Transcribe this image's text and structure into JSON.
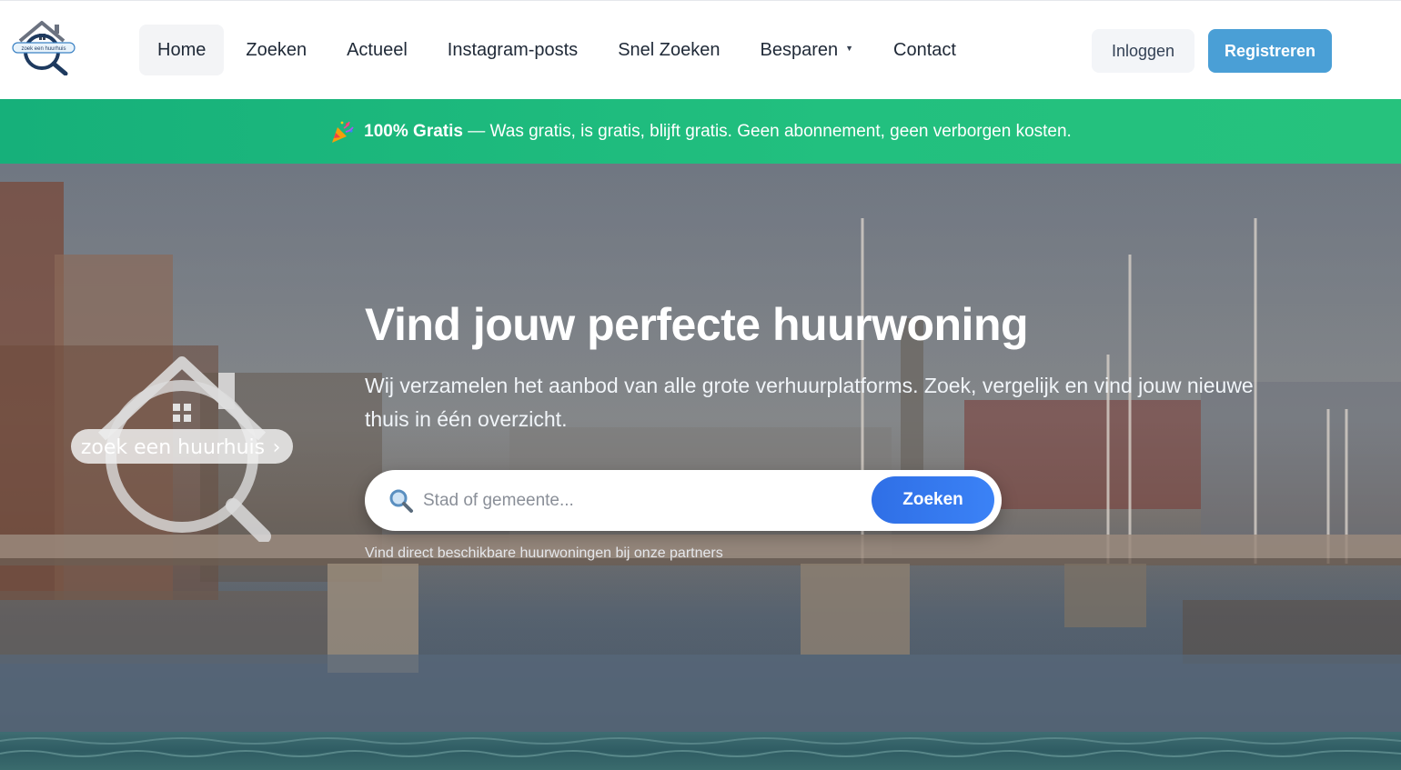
{
  "brand": {
    "logo_text": "zoek een huurhuis",
    "colors": {
      "accent": "#4a9fd6",
      "banner": "#1fb97c",
      "search_button": "#3b82f6"
    }
  },
  "nav": {
    "items": [
      {
        "label": "Home",
        "active": true
      },
      {
        "label": "Zoeken"
      },
      {
        "label": "Actueel"
      },
      {
        "label": "Instagram-posts"
      },
      {
        "label": "Snel Zoeken"
      },
      {
        "label": "Besparen",
        "dropdown": true
      },
      {
        "label": "Contact"
      }
    ],
    "login_label": "Inloggen",
    "register_label": "Registreren"
  },
  "banner": {
    "icon": "party-popper-icon",
    "bold": "100% Gratis",
    "text": "— Was gratis, is gratis, blijft gratis. Geen abonnement, geen verborgen kosten."
  },
  "hero": {
    "title": "Vind jouw perfecte huurwoning",
    "subtitle": "Wij verzamelen het aanbod van alle grote verhuurplatforms. Zoek, vergelijk en vind jouw nieuwe thuis in één overzicht.",
    "search": {
      "placeholder": "Stad of gemeente...",
      "value": "",
      "button_label": "Zoeken",
      "icon": "magnifier-icon"
    },
    "note": "Vind direct beschikbare huurwoningen bij onze partners"
  }
}
